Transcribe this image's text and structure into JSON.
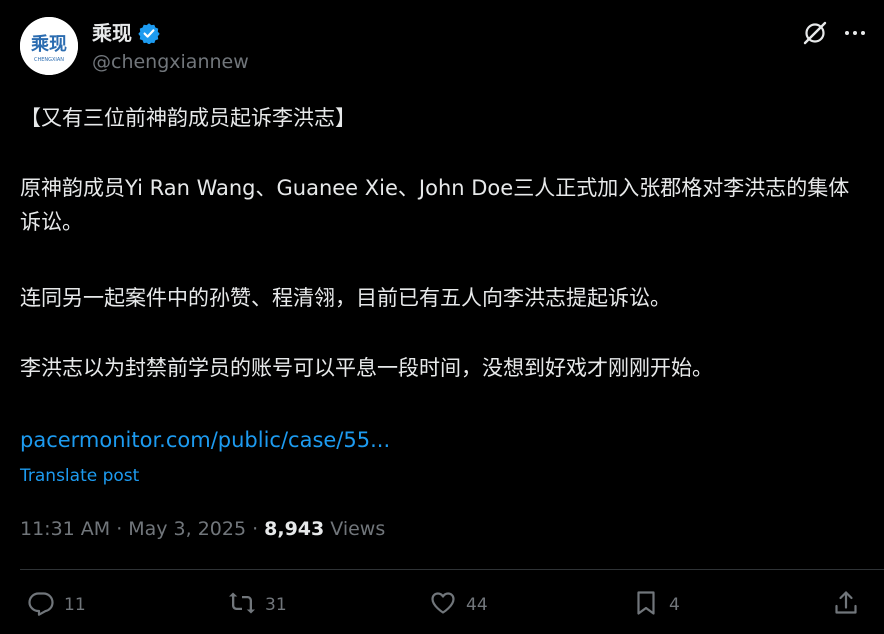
{
  "user": {
    "display_name": "乘现",
    "handle": "@chengxiannew",
    "avatar_text": "乘现",
    "avatar_subtext": "CHENGXIAN"
  },
  "icons": {
    "verified": "verified-badge-icon",
    "grok": "grok-icon",
    "more": "more-dots-icon",
    "reply": "reply-bubble-icon",
    "repost": "repost-arrows-icon",
    "like": "heart-icon",
    "bookmark": "bookmark-icon",
    "share": "share-upload-icon"
  },
  "post": {
    "title": "【又有三位前神韵成员起诉李洪志】",
    "paragraph_1": "原神韵成员Yi Ran Wang、Guanee Xie、John Doe三人正式加入张郡格对李洪志的集体诉讼。",
    "paragraph_2": "连同另一起案件中的孙赞、程清翎，目前已有五人向李洪志提起诉讼。",
    "paragraph_3": "李洪志以为封禁前学员的账号可以平息一段时间，没想到好戏才刚刚开始。",
    "link_text": "pacermonitor.com/public/case/55...",
    "translate_label": "Translate post"
  },
  "meta": {
    "time": "11:31 AM",
    "separator": "·",
    "date": "May 3, 2025",
    "views_count": "8,943",
    "views_label": "Views"
  },
  "actions": {
    "replies": "11",
    "reposts": "31",
    "likes": "44",
    "bookmarks": "4"
  },
  "colors": {
    "background": "#000000",
    "text": "#e7e9ea",
    "secondary": "#71767b",
    "link": "#1d9bf0",
    "divider": "#2f3336",
    "avatar_blue": "#2b6cb0"
  }
}
